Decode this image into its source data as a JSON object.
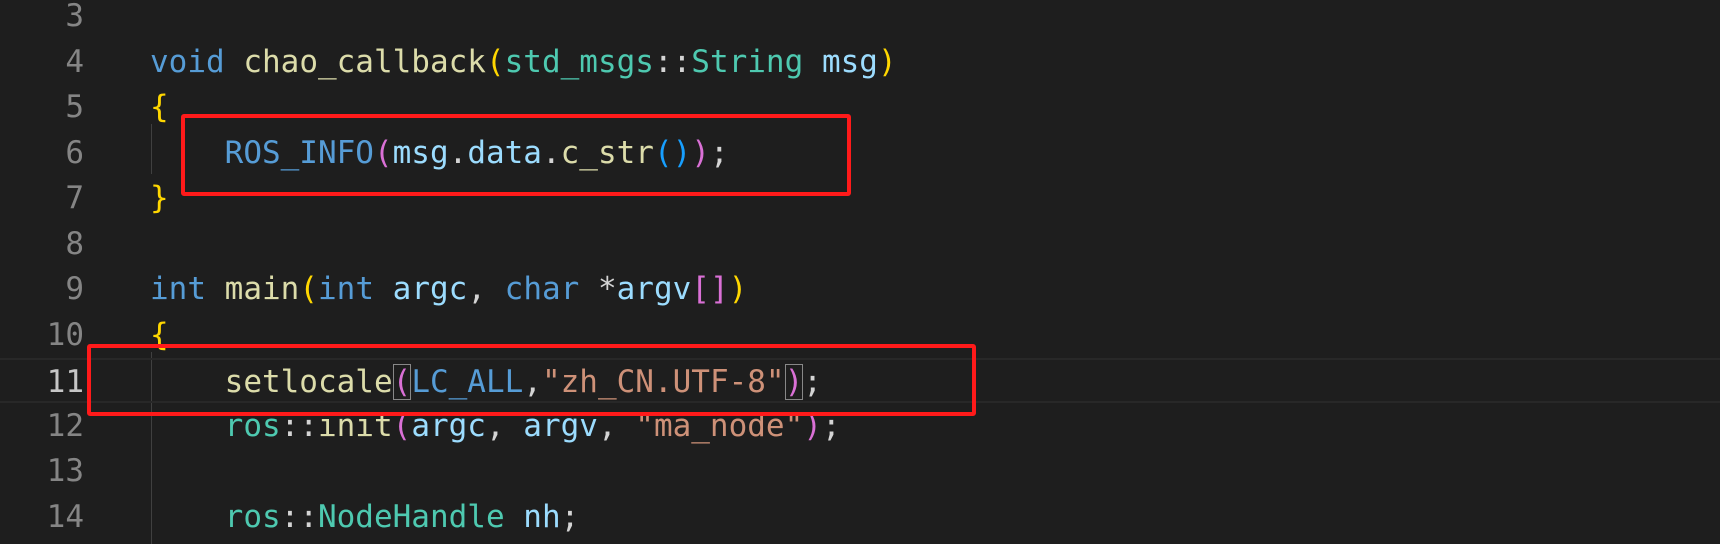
{
  "editor": {
    "lines": [
      {
        "number": "3",
        "tokens": []
      },
      {
        "number": "4",
        "tokens": [
          {
            "text": "void",
            "cls": "t-kw"
          },
          {
            "text": " ",
            "cls": "t-plain"
          },
          {
            "text": "chao_callback",
            "cls": "t-fn"
          },
          {
            "text": "(",
            "cls": "br1"
          },
          {
            "text": "std_msgs",
            "cls": "t-ty"
          },
          {
            "text": "::",
            "cls": "t-plain"
          },
          {
            "text": "String",
            "cls": "t-ty"
          },
          {
            "text": " ",
            "cls": "t-plain"
          },
          {
            "text": "msg",
            "cls": "t-var"
          },
          {
            "text": ")",
            "cls": "br1"
          }
        ]
      },
      {
        "number": "5",
        "tokens": [
          {
            "text": "{",
            "cls": "br1"
          }
        ]
      },
      {
        "number": "6",
        "tokens": [
          {
            "text": "    ",
            "cls": "t-plain"
          },
          {
            "text": "ROS_INFO",
            "cls": "t-macro"
          },
          {
            "text": "(",
            "cls": "br2"
          },
          {
            "text": "msg",
            "cls": "t-var"
          },
          {
            "text": ".",
            "cls": "t-plain"
          },
          {
            "text": "data",
            "cls": "t-var"
          },
          {
            "text": ".",
            "cls": "t-plain"
          },
          {
            "text": "c_str",
            "cls": "t-fn"
          },
          {
            "text": "()",
            "cls": "br3"
          },
          {
            "text": ")",
            "cls": "br2"
          },
          {
            "text": ";",
            "cls": "t-plain"
          }
        ]
      },
      {
        "number": "7",
        "tokens": [
          {
            "text": "}",
            "cls": "br1"
          }
        ]
      },
      {
        "number": "8",
        "tokens": []
      },
      {
        "number": "9",
        "tokens": [
          {
            "text": "int",
            "cls": "t-kw"
          },
          {
            "text": " ",
            "cls": "t-plain"
          },
          {
            "text": "main",
            "cls": "t-fn"
          },
          {
            "text": "(",
            "cls": "br1"
          },
          {
            "text": "int",
            "cls": "t-kw"
          },
          {
            "text": " ",
            "cls": "t-plain"
          },
          {
            "text": "argc",
            "cls": "t-var"
          },
          {
            "text": ", ",
            "cls": "t-plain"
          },
          {
            "text": "char",
            "cls": "t-kw"
          },
          {
            "text": " *",
            "cls": "t-plain"
          },
          {
            "text": "argv",
            "cls": "t-var"
          },
          {
            "text": "[]",
            "cls": "br2"
          },
          {
            "text": ")",
            "cls": "br1"
          }
        ]
      },
      {
        "number": "10",
        "tokens": [
          {
            "text": "{",
            "cls": "br1"
          }
        ]
      },
      {
        "number": "11",
        "current": true,
        "tokens": [
          {
            "text": "    ",
            "cls": "t-plain"
          },
          {
            "text": "setlocale",
            "cls": "t-fn"
          },
          {
            "text": "(",
            "cls": "br2",
            "match": true
          },
          {
            "text": "LC_ALL",
            "cls": "t-macro"
          },
          {
            "text": ",",
            "cls": "t-plain"
          },
          {
            "text": "\"zh_CN.UTF-8\"",
            "cls": "t-str"
          },
          {
            "text": ")",
            "cls": "br2",
            "match": true
          },
          {
            "text": ";",
            "cls": "t-plain"
          }
        ]
      },
      {
        "number": "12",
        "tokens": [
          {
            "text": "    ",
            "cls": "t-plain"
          },
          {
            "text": "ros",
            "cls": "t-ty"
          },
          {
            "text": "::",
            "cls": "t-plain"
          },
          {
            "text": "init",
            "cls": "t-fn"
          },
          {
            "text": "(",
            "cls": "br2"
          },
          {
            "text": "argc",
            "cls": "t-var"
          },
          {
            "text": ", ",
            "cls": "t-plain"
          },
          {
            "text": "argv",
            "cls": "t-var"
          },
          {
            "text": ", ",
            "cls": "t-plain"
          },
          {
            "text": "\"ma_node\"",
            "cls": "t-str"
          },
          {
            "text": ")",
            "cls": "br2"
          },
          {
            "text": ";",
            "cls": "t-plain"
          }
        ]
      },
      {
        "number": "13",
        "tokens": []
      },
      {
        "number": "14",
        "tokens": [
          {
            "text": "    ",
            "cls": "t-plain"
          },
          {
            "text": "ros",
            "cls": "t-ty"
          },
          {
            "text": "::",
            "cls": "t-plain"
          },
          {
            "text": "NodeHandle",
            "cls": "t-ty"
          },
          {
            "text": " ",
            "cls": "t-plain"
          },
          {
            "text": "nh",
            "cls": "t-var"
          },
          {
            "text": ";",
            "cls": "t-plain"
          }
        ]
      }
    ],
    "active_line": "11",
    "annotation_color": "#ff1a1a"
  }
}
